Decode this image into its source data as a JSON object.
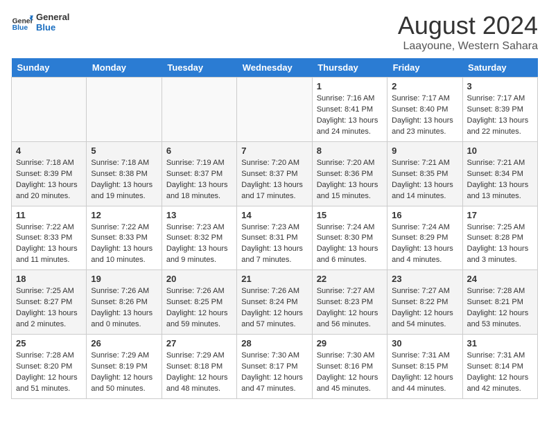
{
  "header": {
    "logo_general": "General",
    "logo_blue": "Blue",
    "month_title": "August 2024",
    "location": "Laayoune, Western Sahara"
  },
  "days_of_week": [
    "Sunday",
    "Monday",
    "Tuesday",
    "Wednesday",
    "Thursday",
    "Friday",
    "Saturday"
  ],
  "weeks": [
    [
      {
        "day": "",
        "info": ""
      },
      {
        "day": "",
        "info": ""
      },
      {
        "day": "",
        "info": ""
      },
      {
        "day": "",
        "info": ""
      },
      {
        "day": "1",
        "info": "Sunrise: 7:16 AM\nSunset: 8:41 PM\nDaylight: 13 hours and 24 minutes."
      },
      {
        "day": "2",
        "info": "Sunrise: 7:17 AM\nSunset: 8:40 PM\nDaylight: 13 hours and 23 minutes."
      },
      {
        "day": "3",
        "info": "Sunrise: 7:17 AM\nSunset: 8:39 PM\nDaylight: 13 hours and 22 minutes."
      }
    ],
    [
      {
        "day": "4",
        "info": "Sunrise: 7:18 AM\nSunset: 8:39 PM\nDaylight: 13 hours and 20 minutes."
      },
      {
        "day": "5",
        "info": "Sunrise: 7:18 AM\nSunset: 8:38 PM\nDaylight: 13 hours and 19 minutes."
      },
      {
        "day": "6",
        "info": "Sunrise: 7:19 AM\nSunset: 8:37 PM\nDaylight: 13 hours and 18 minutes."
      },
      {
        "day": "7",
        "info": "Sunrise: 7:20 AM\nSunset: 8:37 PM\nDaylight: 13 hours and 17 minutes."
      },
      {
        "day": "8",
        "info": "Sunrise: 7:20 AM\nSunset: 8:36 PM\nDaylight: 13 hours and 15 minutes."
      },
      {
        "day": "9",
        "info": "Sunrise: 7:21 AM\nSunset: 8:35 PM\nDaylight: 13 hours and 14 minutes."
      },
      {
        "day": "10",
        "info": "Sunrise: 7:21 AM\nSunset: 8:34 PM\nDaylight: 13 hours and 13 minutes."
      }
    ],
    [
      {
        "day": "11",
        "info": "Sunrise: 7:22 AM\nSunset: 8:33 PM\nDaylight: 13 hours and 11 minutes."
      },
      {
        "day": "12",
        "info": "Sunrise: 7:22 AM\nSunset: 8:33 PM\nDaylight: 13 hours and 10 minutes."
      },
      {
        "day": "13",
        "info": "Sunrise: 7:23 AM\nSunset: 8:32 PM\nDaylight: 13 hours and 9 minutes."
      },
      {
        "day": "14",
        "info": "Sunrise: 7:23 AM\nSunset: 8:31 PM\nDaylight: 13 hours and 7 minutes."
      },
      {
        "day": "15",
        "info": "Sunrise: 7:24 AM\nSunset: 8:30 PM\nDaylight: 13 hours and 6 minutes."
      },
      {
        "day": "16",
        "info": "Sunrise: 7:24 AM\nSunset: 8:29 PM\nDaylight: 13 hours and 4 minutes."
      },
      {
        "day": "17",
        "info": "Sunrise: 7:25 AM\nSunset: 8:28 PM\nDaylight: 13 hours and 3 minutes."
      }
    ],
    [
      {
        "day": "18",
        "info": "Sunrise: 7:25 AM\nSunset: 8:27 PM\nDaylight: 13 hours and 2 minutes."
      },
      {
        "day": "19",
        "info": "Sunrise: 7:26 AM\nSunset: 8:26 PM\nDaylight: 13 hours and 0 minutes."
      },
      {
        "day": "20",
        "info": "Sunrise: 7:26 AM\nSunset: 8:25 PM\nDaylight: 12 hours and 59 minutes."
      },
      {
        "day": "21",
        "info": "Sunrise: 7:26 AM\nSunset: 8:24 PM\nDaylight: 12 hours and 57 minutes."
      },
      {
        "day": "22",
        "info": "Sunrise: 7:27 AM\nSunset: 8:23 PM\nDaylight: 12 hours and 56 minutes."
      },
      {
        "day": "23",
        "info": "Sunrise: 7:27 AM\nSunset: 8:22 PM\nDaylight: 12 hours and 54 minutes."
      },
      {
        "day": "24",
        "info": "Sunrise: 7:28 AM\nSunset: 8:21 PM\nDaylight: 12 hours and 53 minutes."
      }
    ],
    [
      {
        "day": "25",
        "info": "Sunrise: 7:28 AM\nSunset: 8:20 PM\nDaylight: 12 hours and 51 minutes."
      },
      {
        "day": "26",
        "info": "Sunrise: 7:29 AM\nSunset: 8:19 PM\nDaylight: 12 hours and 50 minutes."
      },
      {
        "day": "27",
        "info": "Sunrise: 7:29 AM\nSunset: 8:18 PM\nDaylight: 12 hours and 48 minutes."
      },
      {
        "day": "28",
        "info": "Sunrise: 7:30 AM\nSunset: 8:17 PM\nDaylight: 12 hours and 47 minutes."
      },
      {
        "day": "29",
        "info": "Sunrise: 7:30 AM\nSunset: 8:16 PM\nDaylight: 12 hours and 45 minutes."
      },
      {
        "day": "30",
        "info": "Sunrise: 7:31 AM\nSunset: 8:15 PM\nDaylight: 12 hours and 44 minutes."
      },
      {
        "day": "31",
        "info": "Sunrise: 7:31 AM\nSunset: 8:14 PM\nDaylight: 12 hours and 42 minutes."
      }
    ]
  ]
}
